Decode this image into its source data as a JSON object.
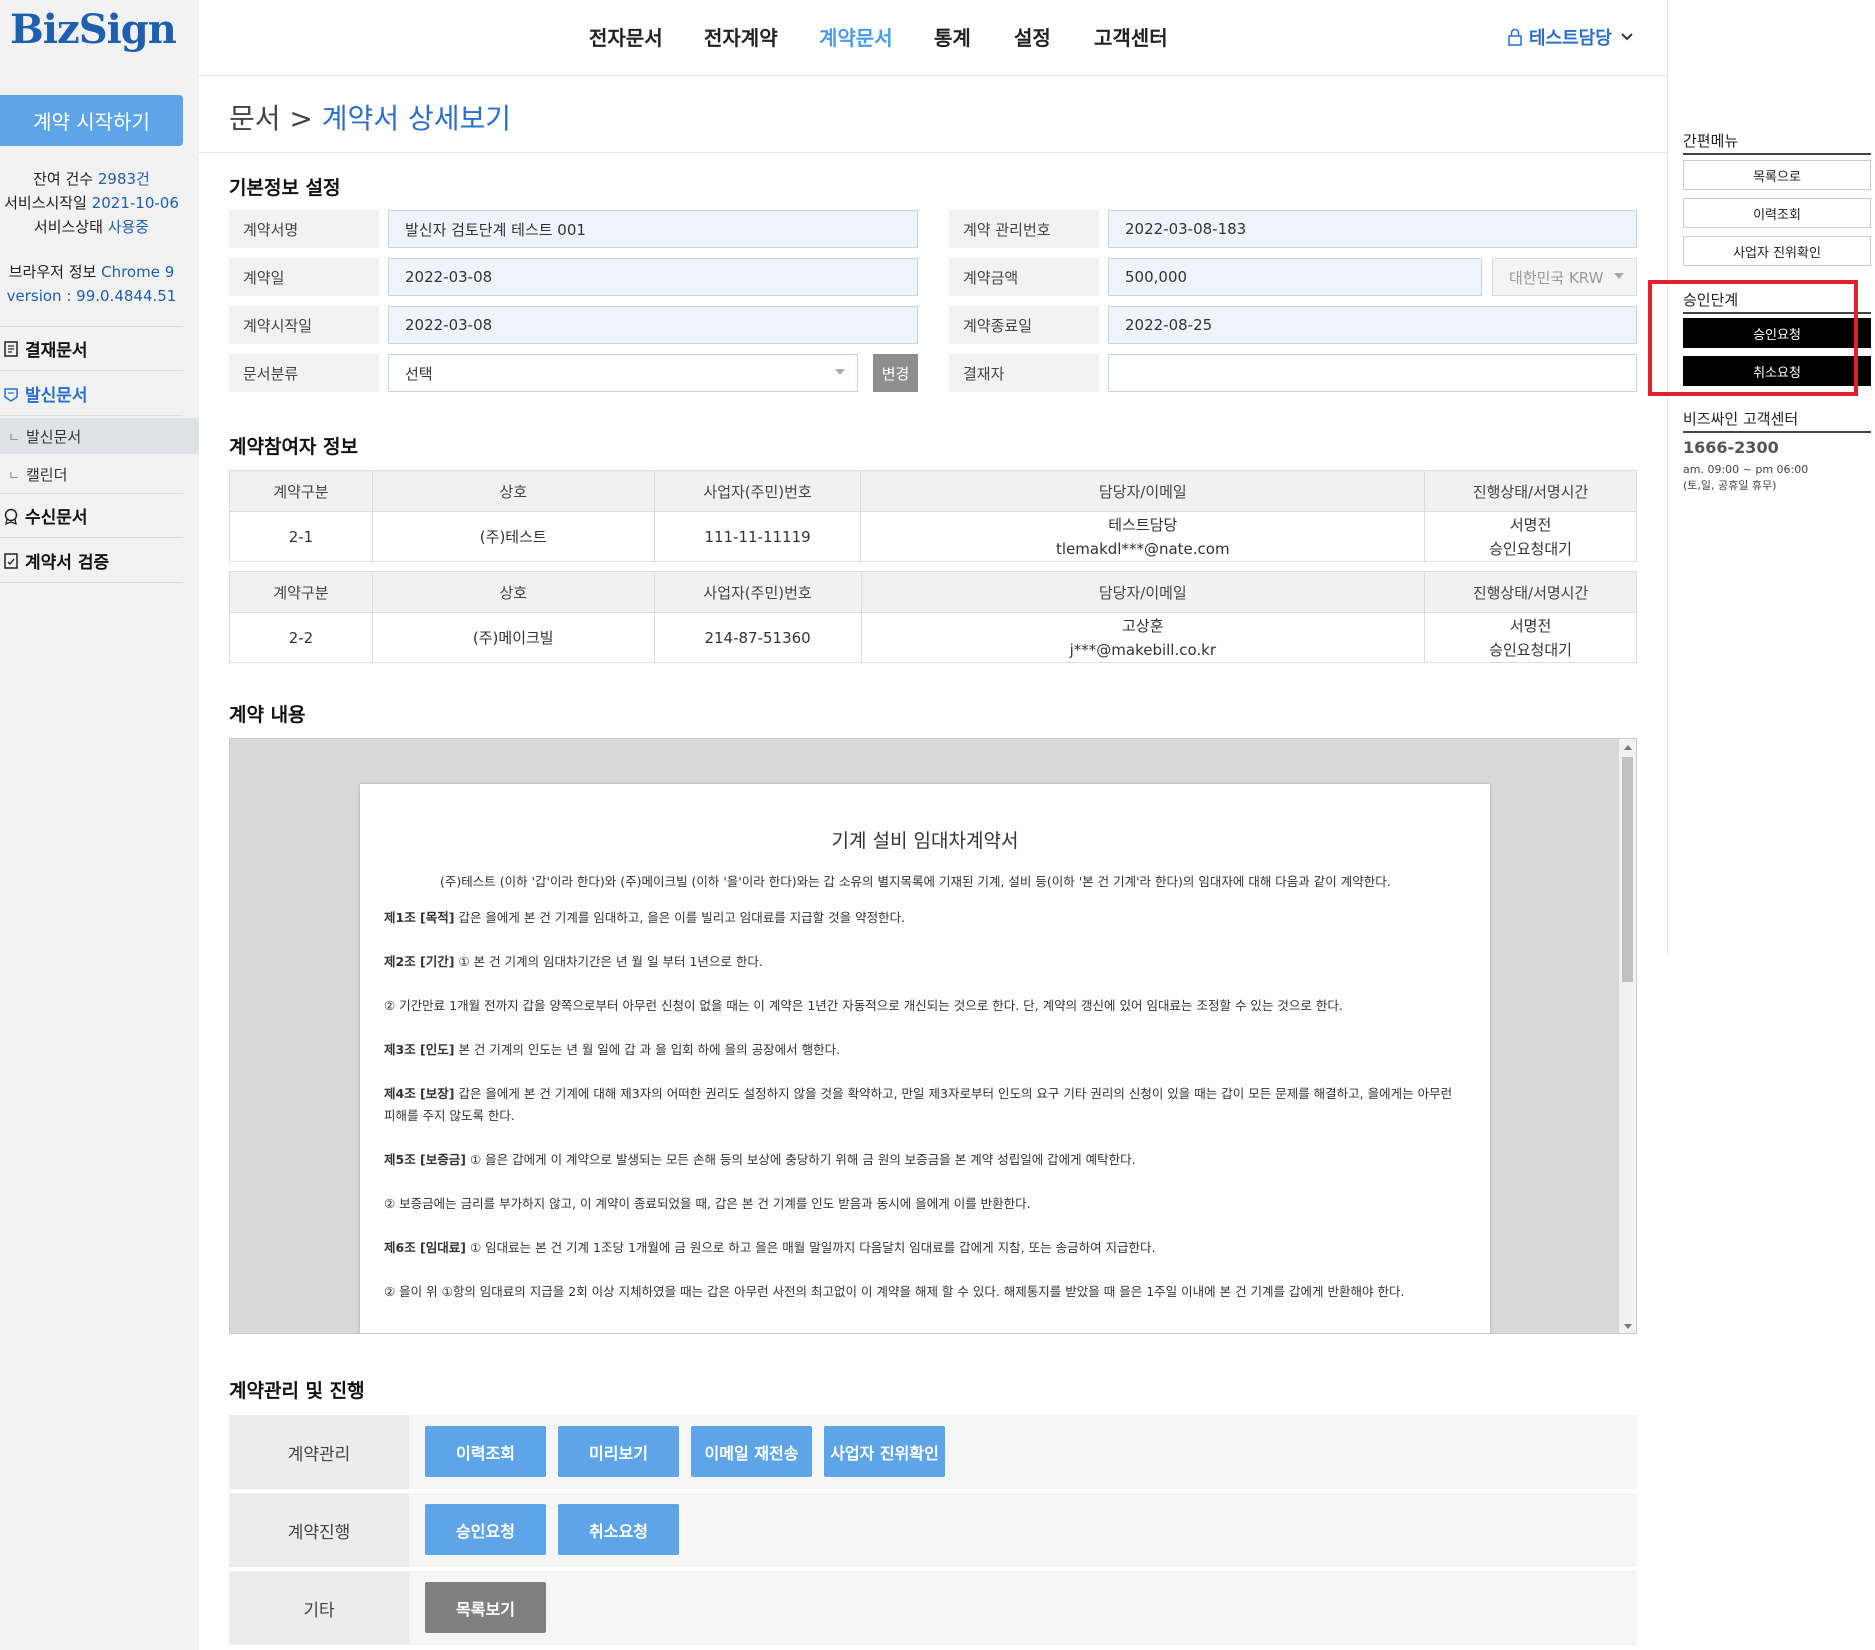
{
  "logo": "BizSign",
  "sidebar": {
    "start_button": "계약 시작하기",
    "remaining_label": "잔여 건수",
    "remaining_value": "2983건",
    "service_start_label": "서비스시작일",
    "service_start_value": "2021-10-06",
    "service_status_label": "서비스상태",
    "service_status_value": "사용중",
    "browser_label": "브라우저 정보",
    "browser_value": "Chrome 9",
    "version_value": "version : 99.0.4844.51",
    "items": [
      {
        "label": "결재문서"
      },
      {
        "label": "발신문서"
      },
      {
        "label": "발신문서"
      },
      {
        "label": "캘린더"
      },
      {
        "label": "수신문서"
      },
      {
        "label": "계약서 검증"
      }
    ],
    "sub_prefix": "ㄴ"
  },
  "topnav": {
    "items": [
      "전자문서",
      "전자계약",
      "계약문서",
      "통계",
      "설정",
      "고객센터"
    ],
    "active": "계약문서",
    "user": "테스트담당"
  },
  "breadcrumb": {
    "parent": "문서",
    "sep": " > ",
    "current": "계약서 상세보기"
  },
  "basic_info": {
    "title": "기본정보 설정",
    "contract_name_label": "계약서명",
    "contract_name_value": "발신자 검토단계 테스트 001",
    "mgmt_no_label": "계약 관리번호",
    "mgmt_no_value": "2022-03-08-183",
    "contract_date_label": "계약일",
    "contract_date_value": "2022-03-08",
    "amount_label": "계약금액",
    "amount_value": "500,000",
    "currency": "대한민국 KRW",
    "start_date_label": "계약시작일",
    "start_date_value": "2022-03-08",
    "end_date_label": "계약종료일",
    "end_date_value": "2022-08-25",
    "category_label": "문서분류",
    "category_value": "선택",
    "change_button": "변경",
    "approver_label": "결재자",
    "approver_value": ""
  },
  "participants": {
    "title": "계약참여자 정보",
    "headers": [
      "계약구분",
      "상호",
      "사업자(주민)번호",
      "담당자/이메일",
      "진행상태/서명시간"
    ],
    "rows": [
      {
        "type": "2-1",
        "company": "(주)테스트",
        "biz_no": "111-11-11119",
        "manager": "테스트담당",
        "email": "tlemakdl***@nate.com",
        "status1": "서명전",
        "status2": "승인요청대기"
      },
      {
        "type": "2-2",
        "company": "(주)메이크빌",
        "biz_no": "214-87-51360",
        "manager": "고상훈",
        "email": "j***@makebill.co.kr",
        "status1": "서명전",
        "status2": "승인요청대기"
      }
    ]
  },
  "contract_content": {
    "title": "계약 내용",
    "doc_title": "기계 설비 임대차계약서",
    "paragraphs": [
      {
        "bold": "",
        "text": "(주)테스트 (이하 '갑'이라 한다)와 (주)메이크빌 (이하 '을'이라 한다)와는 갑 소유의 별지목록에 기재된 기계, 설비 등(이하 '본 건 기계'라 한다)의 임대자에 대해 다음과 같이 계약한다.",
        "indent": true
      },
      {
        "bold": "제1조 [목적]",
        "text": " 갑은 을에게 본 건 기계를 임대하고, 을은 이를 빌리고 임대료를 지급할 것을 약정한다."
      },
      {
        "bold": "제2조 [기간]",
        "text": " ① 본 건 기계의 임대차기간은    년    월    일 부터 1년으로 한다."
      },
      {
        "bold": "",
        "text": "② 기간만료 1개월 전까지 갑을 양쪽으로부터 아무런 신청이 없을 때는 이 계약은 1년간 자동적으로 개신되는 것으로 한다. 단, 계약의 갱신에 있어 임대료는 조정할 수 있는 것으로 한다."
      },
      {
        "bold": "제3조 [인도]",
        "text": " 본 건 기계의 인도는    년    월    일에 갑 과 을 입회 하에 을의 공장에서 행한다."
      },
      {
        "bold": "제4조 [보장]",
        "text": " 갑은 을에게 본 건 기계에 대해 제3자의 어떠한 권리도 설정하지 않을 것을 확약하고, 만일 제3자로부터 인도의 요구 기타 권리의 신청이 있을 때는 갑이 모든 문제를 해결하고, 을에게는 아무런 피해를 주지 않도록 한다."
      },
      {
        "bold": "제5조 [보증금]",
        "text": " ① 을은 갑에게 이 계약으로 발생되는 모든 손해 등의 보상에 충당하기 위해 금 원의 보증금을 본 계약 성립일에 갑에게 예탁한다."
      },
      {
        "bold": "",
        "text": "② 보증금에는 금리를 부가하지 않고, 이 계약이 종료되었을 때, 갑은 본 건 기계를 인도 받음과 동시에 을에게 이를 반환한다."
      },
      {
        "bold": "제6조 [임대료]",
        "text": " ① 임대료는 본 건 기계 1조당 1개월에 금      원으로 하고 을은 매월 말일까지 다음달치 임대료를 갑에게 지참, 또는 송금하여 지급한다."
      },
      {
        "bold": "",
        "text": "② 을이 위 ①항의 임대료의 지급을 2회 이상 지체하였을 때는 갑은 아무런 사전의 최고없이 이 계약을 해제 할 수 있다. 해제통지를 받았을 때 을은 1주일 이내에 본 건 기계를 갑에게 반환해야 한다."
      }
    ]
  },
  "management": {
    "title": "계약관리 및 진행",
    "rows": [
      {
        "label": "계약관리",
        "buttons": [
          "이력조회",
          "미리보기",
          "이메일 재전송",
          "사업자 진위확인"
        ]
      },
      {
        "label": "계약진행",
        "buttons": [
          "승인요청",
          "취소요청"
        ]
      },
      {
        "label": "기타",
        "buttons": [
          "목록보기"
        ]
      }
    ]
  },
  "right_panel": {
    "quick_menu_title": "간편메뉴",
    "quick_buttons": [
      "목록으로",
      "이력조회",
      "사업자 진위확인"
    ],
    "approval_title": "승인단계",
    "approval_buttons": [
      "승인요청",
      "취소요청"
    ],
    "support_title": "비즈싸인 고객센터",
    "phone": "1666-2300",
    "hours": "am. 09:00 ~ pm 06:00",
    "holiday": "(토,일, 공휴일 휴무)"
  },
  "colors": {
    "brand": "#1f5fae",
    "accent": "#5ea5e8",
    "active_nav": "#4c9be6",
    "highlight_box": "#e0202a"
  }
}
